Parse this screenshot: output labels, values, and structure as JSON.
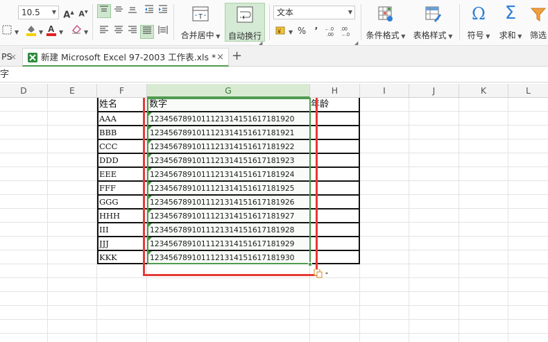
{
  "ribbon": {
    "font_size": "10.5",
    "merge_center_label": "合并居中",
    "wrap_text_label": "自动换行",
    "number_format": "文本",
    "cond_format_label": "条件格式",
    "table_style_label": "表格样式",
    "symbol_label": "符号",
    "sum_label": "求和",
    "filter_label": "筛选",
    "percent_symbol": "%",
    "comma_symbol": "’",
    "inc_decimal": ".0\n.00",
    "dec_decimal": ".00\n.0"
  },
  "tabs": {
    "prev_label": "PS",
    "active_label": "新建 Microsoft Excel 97-2003 工作表.xls *",
    "close_symbol": "×",
    "new_symbol": "+"
  },
  "formula_bar": {
    "content": "字"
  },
  "columns": [
    "D",
    "E",
    "F",
    "G",
    "H",
    "I",
    "J",
    "K",
    "L"
  ],
  "table": {
    "header_name": "姓名",
    "header_number": "数字",
    "header_age": "年龄",
    "rows": [
      {
        "name": "AAA",
        "number": "1234567891011121314151617181920"
      },
      {
        "name": "BBB",
        "number": "1234567891011121314151617181921"
      },
      {
        "name": "CCC",
        "number": "1234567891011121314151617181922"
      },
      {
        "name": "DDD",
        "number": "1234567891011121314151617181923"
      },
      {
        "name": "EEE",
        "number": "1234567891011121314151617181924"
      },
      {
        "name": "FFF",
        "number": "1234567891011121314151617181925"
      },
      {
        "name": "GGG",
        "number": "1234567891011121314151617181926"
      },
      {
        "name": "HHH",
        "number": "1234567891011121314151617181927"
      },
      {
        "name": "III",
        "number": "1234567891011121314151617181928"
      },
      {
        "name": "JJJ",
        "number": "1234567891011121314151617181929"
      },
      {
        "name": "KKK",
        "number": "1234567891011121314151617181930"
      }
    ]
  },
  "colors": {
    "accent_green": "#4f9a4f",
    "highlight_red": "#e53935",
    "icon_blue": "#2f7fd6",
    "filter_orange": "#f0a040"
  }
}
